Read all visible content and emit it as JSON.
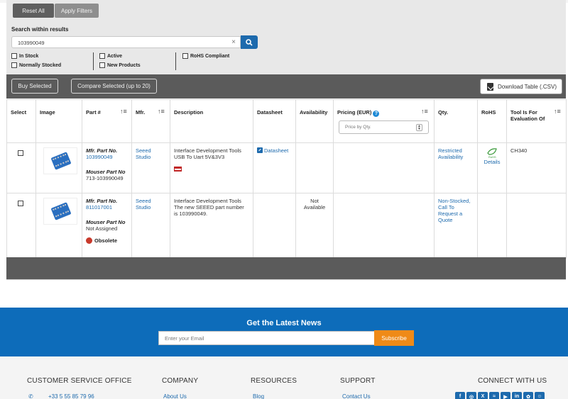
{
  "filters": {
    "reset_label": "Reset All",
    "apply_label": "Apply Filters",
    "search_label": "Search within results",
    "search_value": "103990049",
    "clear_symbol": "×",
    "checkboxes": {
      "in_stock": "In Stock",
      "normally_stocked": "Normally Stocked",
      "active": "Active",
      "new_products": "New Products",
      "rohs": "RoHS Compliant"
    }
  },
  "toolbar": {
    "buy_selected": "Buy Selected",
    "compare_selected": "Compare Selected (up to 20)",
    "download": "Download Table (.CSV)"
  },
  "table": {
    "headers": {
      "select": "Select",
      "image": "Image",
      "part": "Part #",
      "mfr": "Mfr.",
      "description": "Description",
      "datasheet": "Datasheet",
      "availability": "Availability",
      "pricing": "Pricing (EUR)",
      "qty": "Qty.",
      "rohs": "RoHS",
      "tool_for": "Tool Is For Evaluation Of"
    },
    "price_placeholder": "Price by Qty.",
    "rows": [
      {
        "mfr_part_label": "Mfr. Part No.",
        "mfr_part": "103990049",
        "mouser_part_label": "Mouser Part No",
        "mouser_part": "713-103990049",
        "mfr": "Seeed Studio",
        "description": "Interface Development Tools USB To Uart 5V&3V3",
        "datasheet": "Datasheet",
        "availability": "",
        "qty": "Restricted Availability",
        "rohs_details": "Details",
        "tool_for": "CH340"
      },
      {
        "mfr_part_label": "Mfr. Part No.",
        "mfr_part": "811017001",
        "mouser_part_label": "Mouser Part No",
        "mouser_part": "Not Assigned",
        "status": "Obsolete",
        "mfr": "Seeed Studio",
        "description": "Interface Development Tools The new SEEED part number is 103990049.",
        "datasheet": "",
        "availability": "Not Available",
        "qty": "Non-Stocked, Call To Request a Quote",
        "rohs_details": "",
        "tool_for": ""
      }
    ]
  },
  "newsletter": {
    "title": "Get the Latest News",
    "email_placeholder": "Enter your Email",
    "subscribe": "Subscribe"
  },
  "footer": {
    "customer_service": "CUSTOMER SERVICE OFFICE",
    "phone": "+33 5 55 85 79 96",
    "company": "COMPANY",
    "about": "About Us",
    "resources": "RESOURCES",
    "blog": "Blog",
    "support": "SUPPORT",
    "contact": "Contact Us",
    "connect": "CONNECT WITH US"
  },
  "colors": {
    "brand_blue": "#1d6aad",
    "toolbar_grey": "#5b5b5b",
    "newsletter_blue": "#0d6cba",
    "subscribe_orange": "#ef8a17"
  },
  "icons": [
    "search-icon",
    "download-icon",
    "info-icon",
    "sort-icon",
    "datasheet-icon",
    "flag-icon",
    "obsolete-icon",
    "rohs-icon",
    "phone-icon",
    "facebook-icon",
    "instagram-icon",
    "x-icon",
    "rss-icon",
    "youtube-icon",
    "linkedin-icon",
    "other-social-icon",
    "wechat-icon"
  ]
}
